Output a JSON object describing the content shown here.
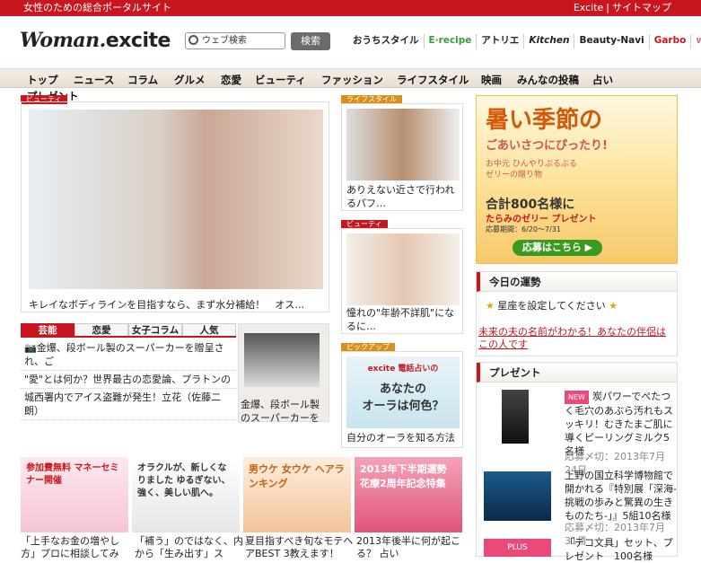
{
  "topbar": {
    "tagline": "女性のための総合ポータルサイト",
    "link1": "Excite",
    "link2": "サイトマップ"
  },
  "logo": {
    "woman": "Woman",
    "excite": "excite"
  },
  "search": {
    "placeholder": "ウェブ検索",
    "button": "検索"
  },
  "brands": [
    "おうちスタイル",
    "E·recipe",
    "アトリエ",
    "Kitchen",
    "Beauty-Navi",
    "Garbo",
    "with"
  ],
  "nav": [
    "トップ",
    "ニュース",
    "コラム",
    "グルメ",
    "恋愛",
    "ビューティ",
    "ファッション",
    "ライフスタイル",
    "映画",
    "みんなの投稿",
    "占い",
    "プレゼント"
  ],
  "feature": {
    "category": "ビューティ",
    "caption": "キレイなボディラインを目指すなら、まず水分補給！　オス…"
  },
  "cards": [
    {
      "category": "ライフスタイル",
      "text": "ありえない近さで行われるパフ…"
    },
    {
      "category": "ビューティ",
      "text": "憧れの\"年齢不詳肌\"になるに…"
    },
    {
      "category": "ピックアップ",
      "text": "自分のオーラを知る方法（無料）",
      "ad_line1": "excite 電話占いの",
      "ad_line2": "あなたの",
      "ad_line3": "オーラは何色？"
    }
  ],
  "tabs": [
    "芸能",
    "恋愛",
    "女子コラム",
    "人気"
  ],
  "tab_items": [
    "金爆、段ボール製のスーパーカーを贈呈され、ご",
    "\"愛\"とは何か？世界最古の恋愛論、プラトンの",
    "城西署内でアイス盗難が発生！立花（佐藤二朗）"
  ],
  "sidebox": {
    "text": "金爆、段ボール製のスーパーカーを"
  },
  "ad": {
    "title": "暑い季節の",
    "sub": "ごあいさつにぴったり!",
    "mid": "お中元 ひんやりぷるぷるゼリーの贈り物",
    "count": "合計800名様に",
    "present": "たらみのゼリー プレゼント",
    "period": "応募期間：6/20〜7/31",
    "button": "応募はこちら ▶"
  },
  "fortune": {
    "heading": "今日の運勢",
    "text": "星座を設定してください",
    "link": "未来の夫の名前がわかる！あなたの伴侶はこの人です"
  },
  "present": {
    "heading": "プレゼント",
    "items": [
      {
        "badge": "NEW",
        "text": "炭パワーでぺたつく毛穴のあぶら汚れもスッキリ！むきたまご肌に導くピーリングミルク5名様",
        "date": "応募〆切：2013年7月24日"
      },
      {
        "badge": "",
        "text": "上野の国立科学博物館で開かれる『特別展「深海-挑戦の歩みと驚異の生きものたち-」』5組10名様",
        "date": "応募〆切：2013年7月31日"
      },
      {
        "badge": "PLUS",
        "text": "「デコ文具」セット、プレゼント　100名様",
        "date": ""
      }
    ]
  },
  "bottom": [
    {
      "label": "参加費無料 マネーセミナー開催",
      "text": "「上手なお金の増やし方」プロに相談してみ"
    },
    {
      "label": "オラクルが、新しくなりました ゆるぎない、強く、美しい肌へ。",
      "text": "「補う」のではなく、内から「生み出す」ス"
    },
    {
      "label": "男ウケ 女ウケ ヘアランキング",
      "text": "夏目指すべき旬なモテヘアBEST 3教えます！"
    },
    {
      "label": "2013年下半期運勢 花療2周年記念特集",
      "text": "2013年後半に何が起こる？ 占い"
    }
  ]
}
